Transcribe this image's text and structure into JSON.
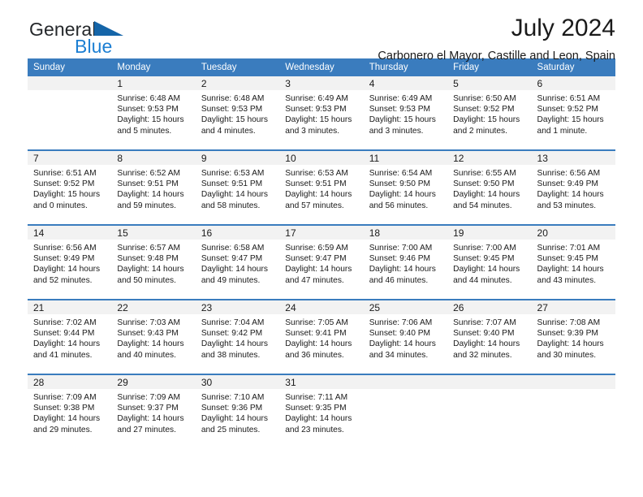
{
  "branding": {
    "logo_primary": "General",
    "logo_secondary": "Blue",
    "logo_accent_color": "#1c7fd3",
    "logo_text_color": "#25282b"
  },
  "header": {
    "title": "July 2024",
    "subtitle": "Carbonero el Mayor, Castille and Leon, Spain"
  },
  "theme": {
    "header_row_bg": "#3a7cbe",
    "header_row_text": "#ffffff",
    "daynum_band_bg": "#f2f2f2",
    "row_divider": "#3a7cbe"
  },
  "weekdays": [
    "Sunday",
    "Monday",
    "Tuesday",
    "Wednesday",
    "Thursday",
    "Friday",
    "Saturday"
  ],
  "weeks": [
    [
      {
        "day": ""
      },
      {
        "day": "1",
        "sunrise": "Sunrise: 6:48 AM",
        "sunset": "Sunset: 9:53 PM",
        "daylight_1": "Daylight: 15 hours",
        "daylight_2": "and 5 minutes."
      },
      {
        "day": "2",
        "sunrise": "Sunrise: 6:48 AM",
        "sunset": "Sunset: 9:53 PM",
        "daylight_1": "Daylight: 15 hours",
        "daylight_2": "and 4 minutes."
      },
      {
        "day": "3",
        "sunrise": "Sunrise: 6:49 AM",
        "sunset": "Sunset: 9:53 PM",
        "daylight_1": "Daylight: 15 hours",
        "daylight_2": "and 3 minutes."
      },
      {
        "day": "4",
        "sunrise": "Sunrise: 6:49 AM",
        "sunset": "Sunset: 9:53 PM",
        "daylight_1": "Daylight: 15 hours",
        "daylight_2": "and 3 minutes."
      },
      {
        "day": "5",
        "sunrise": "Sunrise: 6:50 AM",
        "sunset": "Sunset: 9:52 PM",
        "daylight_1": "Daylight: 15 hours",
        "daylight_2": "and 2 minutes."
      },
      {
        "day": "6",
        "sunrise": "Sunrise: 6:51 AM",
        "sunset": "Sunset: 9:52 PM",
        "daylight_1": "Daylight: 15 hours",
        "daylight_2": "and 1 minute."
      }
    ],
    [
      {
        "day": "7",
        "sunrise": "Sunrise: 6:51 AM",
        "sunset": "Sunset: 9:52 PM",
        "daylight_1": "Daylight: 15 hours",
        "daylight_2": "and 0 minutes."
      },
      {
        "day": "8",
        "sunrise": "Sunrise: 6:52 AM",
        "sunset": "Sunset: 9:51 PM",
        "daylight_1": "Daylight: 14 hours",
        "daylight_2": "and 59 minutes."
      },
      {
        "day": "9",
        "sunrise": "Sunrise: 6:53 AM",
        "sunset": "Sunset: 9:51 PM",
        "daylight_1": "Daylight: 14 hours",
        "daylight_2": "and 58 minutes."
      },
      {
        "day": "10",
        "sunrise": "Sunrise: 6:53 AM",
        "sunset": "Sunset: 9:51 PM",
        "daylight_1": "Daylight: 14 hours",
        "daylight_2": "and 57 minutes."
      },
      {
        "day": "11",
        "sunrise": "Sunrise: 6:54 AM",
        "sunset": "Sunset: 9:50 PM",
        "daylight_1": "Daylight: 14 hours",
        "daylight_2": "and 56 minutes."
      },
      {
        "day": "12",
        "sunrise": "Sunrise: 6:55 AM",
        "sunset": "Sunset: 9:50 PM",
        "daylight_1": "Daylight: 14 hours",
        "daylight_2": "and 54 minutes."
      },
      {
        "day": "13",
        "sunrise": "Sunrise: 6:56 AM",
        "sunset": "Sunset: 9:49 PM",
        "daylight_1": "Daylight: 14 hours",
        "daylight_2": "and 53 minutes."
      }
    ],
    [
      {
        "day": "14",
        "sunrise": "Sunrise: 6:56 AM",
        "sunset": "Sunset: 9:49 PM",
        "daylight_1": "Daylight: 14 hours",
        "daylight_2": "and 52 minutes."
      },
      {
        "day": "15",
        "sunrise": "Sunrise: 6:57 AM",
        "sunset": "Sunset: 9:48 PM",
        "daylight_1": "Daylight: 14 hours",
        "daylight_2": "and 50 minutes."
      },
      {
        "day": "16",
        "sunrise": "Sunrise: 6:58 AM",
        "sunset": "Sunset: 9:47 PM",
        "daylight_1": "Daylight: 14 hours",
        "daylight_2": "and 49 minutes."
      },
      {
        "day": "17",
        "sunrise": "Sunrise: 6:59 AM",
        "sunset": "Sunset: 9:47 PM",
        "daylight_1": "Daylight: 14 hours",
        "daylight_2": "and 47 minutes."
      },
      {
        "day": "18",
        "sunrise": "Sunrise: 7:00 AM",
        "sunset": "Sunset: 9:46 PM",
        "daylight_1": "Daylight: 14 hours",
        "daylight_2": "and 46 minutes."
      },
      {
        "day": "19",
        "sunrise": "Sunrise: 7:00 AM",
        "sunset": "Sunset: 9:45 PM",
        "daylight_1": "Daylight: 14 hours",
        "daylight_2": "and 44 minutes."
      },
      {
        "day": "20",
        "sunrise": "Sunrise: 7:01 AM",
        "sunset": "Sunset: 9:45 PM",
        "daylight_1": "Daylight: 14 hours",
        "daylight_2": "and 43 minutes."
      }
    ],
    [
      {
        "day": "21",
        "sunrise": "Sunrise: 7:02 AM",
        "sunset": "Sunset: 9:44 PM",
        "daylight_1": "Daylight: 14 hours",
        "daylight_2": "and 41 minutes."
      },
      {
        "day": "22",
        "sunrise": "Sunrise: 7:03 AM",
        "sunset": "Sunset: 9:43 PM",
        "daylight_1": "Daylight: 14 hours",
        "daylight_2": "and 40 minutes."
      },
      {
        "day": "23",
        "sunrise": "Sunrise: 7:04 AM",
        "sunset": "Sunset: 9:42 PM",
        "daylight_1": "Daylight: 14 hours",
        "daylight_2": "and 38 minutes."
      },
      {
        "day": "24",
        "sunrise": "Sunrise: 7:05 AM",
        "sunset": "Sunset: 9:41 PM",
        "daylight_1": "Daylight: 14 hours",
        "daylight_2": "and 36 minutes."
      },
      {
        "day": "25",
        "sunrise": "Sunrise: 7:06 AM",
        "sunset": "Sunset: 9:40 PM",
        "daylight_1": "Daylight: 14 hours",
        "daylight_2": "and 34 minutes."
      },
      {
        "day": "26",
        "sunrise": "Sunrise: 7:07 AM",
        "sunset": "Sunset: 9:40 PM",
        "daylight_1": "Daylight: 14 hours",
        "daylight_2": "and 32 minutes."
      },
      {
        "day": "27",
        "sunrise": "Sunrise: 7:08 AM",
        "sunset": "Sunset: 9:39 PM",
        "daylight_1": "Daylight: 14 hours",
        "daylight_2": "and 30 minutes."
      }
    ],
    [
      {
        "day": "28",
        "sunrise": "Sunrise: 7:09 AM",
        "sunset": "Sunset: 9:38 PM",
        "daylight_1": "Daylight: 14 hours",
        "daylight_2": "and 29 minutes."
      },
      {
        "day": "29",
        "sunrise": "Sunrise: 7:09 AM",
        "sunset": "Sunset: 9:37 PM",
        "daylight_1": "Daylight: 14 hours",
        "daylight_2": "and 27 minutes."
      },
      {
        "day": "30",
        "sunrise": "Sunrise: 7:10 AM",
        "sunset": "Sunset: 9:36 PM",
        "daylight_1": "Daylight: 14 hours",
        "daylight_2": "and 25 minutes."
      },
      {
        "day": "31",
        "sunrise": "Sunrise: 7:11 AM",
        "sunset": "Sunset: 9:35 PM",
        "daylight_1": "Daylight: 14 hours",
        "daylight_2": "and 23 minutes."
      },
      {
        "day": ""
      },
      {
        "day": ""
      },
      {
        "day": ""
      }
    ]
  ]
}
